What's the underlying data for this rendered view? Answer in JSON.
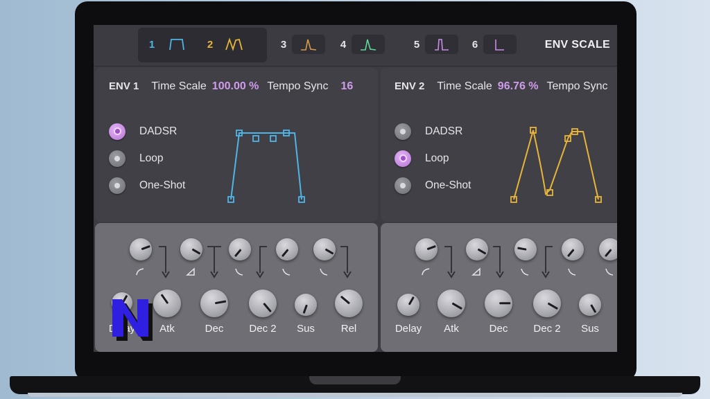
{
  "tabs": [
    {
      "num": "1",
      "color": "#4fb5e6"
    },
    {
      "num": "2",
      "color": "#e8b53a"
    },
    {
      "num": "3",
      "color": "#d89a4a"
    },
    {
      "num": "4",
      "color": "#5ed99a"
    },
    {
      "num": "5",
      "color": "#c98ee8"
    },
    {
      "num": "6",
      "color": "#c98ee8"
    }
  ],
  "header": {
    "env_scale": "ENV SCALE"
  },
  "env1": {
    "title": "ENV 1",
    "time_scale_label": "Time Scale",
    "time_scale_value": "100.00 %",
    "tempo_sync_label": "Tempo Sync",
    "tempo_sync_value": "16",
    "modes": [
      "DADSR",
      "Loop",
      "One-Shot"
    ],
    "selected_mode": "DADSR",
    "color": "#4fb5e6",
    "knobs": [
      "Delay",
      "Atk",
      "Dec",
      "Dec 2",
      "Sus",
      "Rel"
    ]
  },
  "env2": {
    "title": "ENV 2",
    "time_scale_label": "Time Scale",
    "time_scale_value": "96.76 %",
    "tempo_sync_label": "Tempo Sync",
    "tempo_sync_value": "",
    "modes": [
      "DADSR",
      "Loop",
      "One-Shot"
    ],
    "selected_mode": "Loop",
    "color": "#e8b53a",
    "knobs": [
      "Delay",
      "Atk",
      "Dec",
      "Dec 2",
      "Sus"
    ]
  },
  "accent": "#cf9bea",
  "logo": {
    "letter": "N",
    "color": "#2f1fe0"
  }
}
